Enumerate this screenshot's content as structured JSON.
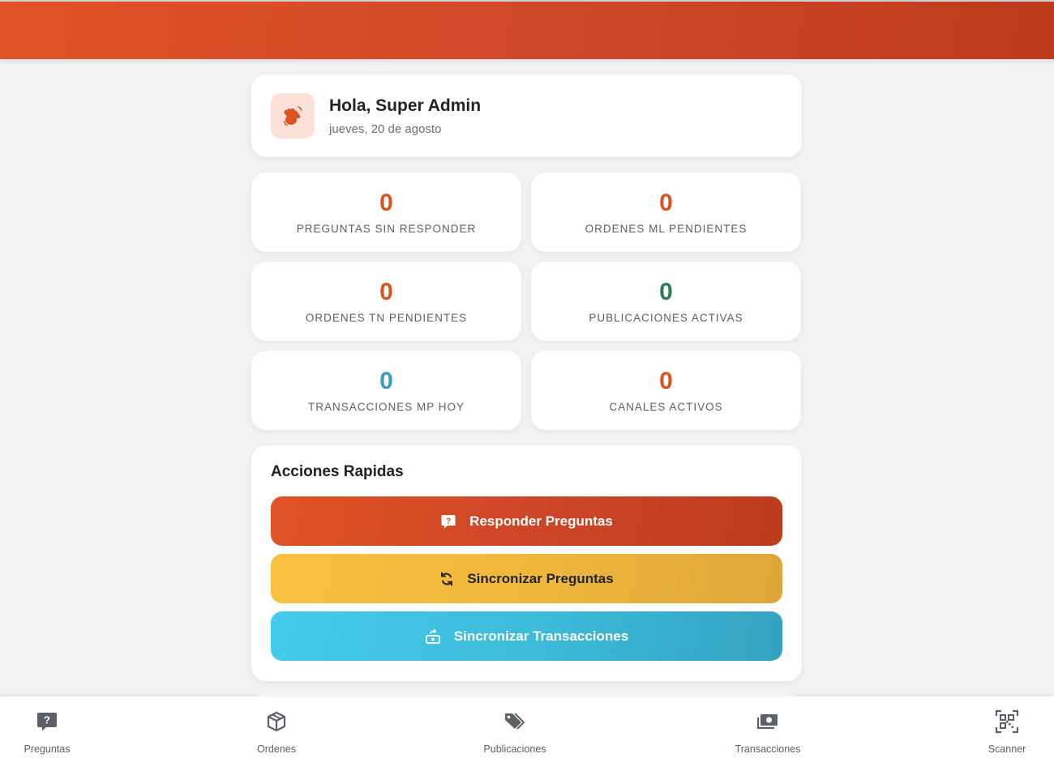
{
  "header": {},
  "greeting": {
    "icon": "waving-hand-icon",
    "title": "Hola, Super Admin",
    "date": "jueves, 20 de agosto"
  },
  "stats": [
    {
      "value": "0",
      "label": "PREGUNTAS SIN RESPONDER",
      "color": "#d9531e"
    },
    {
      "value": "0",
      "label": "ORDENES ML PENDIENTES",
      "color": "#d9531e"
    },
    {
      "value": "0",
      "label": "ORDENES TN PENDIENTES",
      "color": "#d9531e"
    },
    {
      "value": "0",
      "label": "PUBLICACIONES ACTIVAS",
      "color": "#2e7d4f"
    },
    {
      "value": "0",
      "label": "TRANSACCIONES MP HOY",
      "color": "#3a9cc0"
    },
    {
      "value": "0",
      "label": "CANALES ACTIVOS",
      "color": "#d9531e"
    }
  ],
  "actions": {
    "title": "Acciones Rapidas",
    "buttons": [
      {
        "label": "Responder Preguntas",
        "icon": "question-message-icon"
      },
      {
        "label": "Sincronizar Preguntas",
        "icon": "sync-icon"
      },
      {
        "label": "Sincronizar Transacciones",
        "icon": "money-sync-icon"
      }
    ]
  },
  "nav": [
    {
      "label": "Preguntas",
      "icon": "question-message-icon"
    },
    {
      "label": "Ordenes",
      "icon": "box-icon"
    },
    {
      "label": "Publicaciones",
      "icon": "tags-icon"
    },
    {
      "label": "Transacciones",
      "icon": "money-bill-icon"
    },
    {
      "label": "Scanner",
      "icon": "qr-scanner-icon"
    }
  ],
  "colors": {
    "brand": "#d9531e",
    "success": "#2e7d4f",
    "info": "#3a9cc0",
    "warning": "#f5bb3e"
  }
}
